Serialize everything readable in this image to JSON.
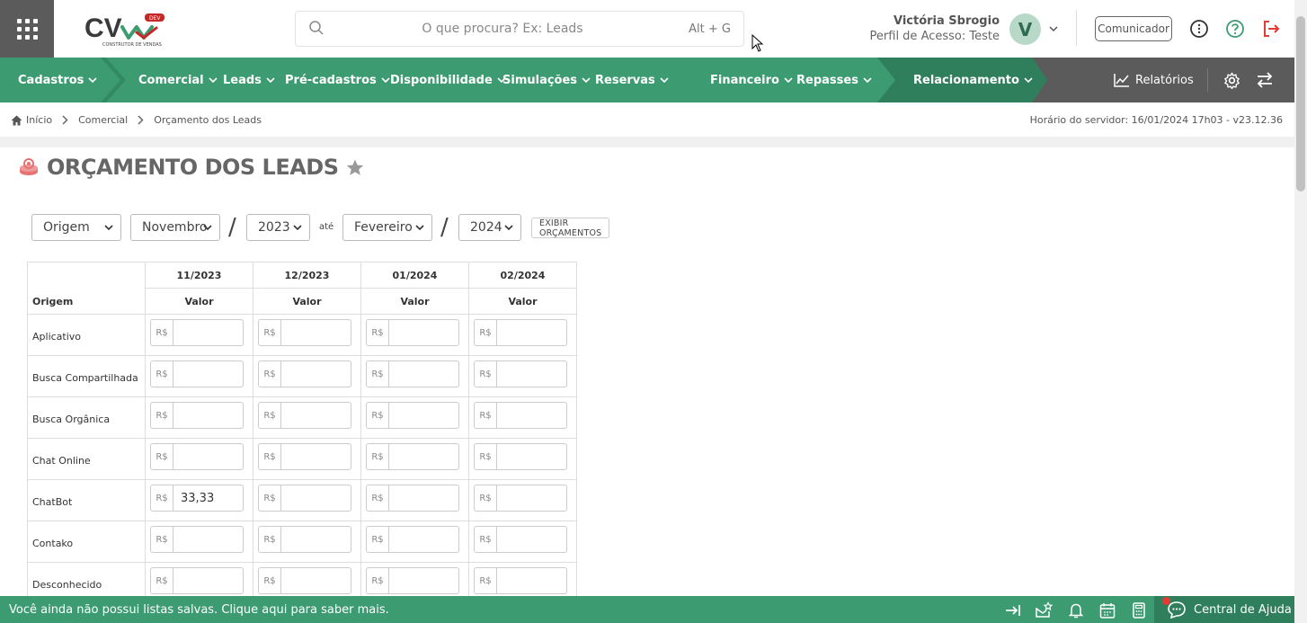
{
  "header": {
    "logo_text": "CV",
    "logo_badge": "DEV",
    "logo_subtitle": "CONSTRUTOR DE VENDAS",
    "search": {
      "placeholder": "O que procura? Ex: Leads",
      "shortcut": "Alt + G"
    },
    "user": {
      "name": "Victória Sbrogio",
      "profile": "Perfil de Acesso: Teste",
      "avatar_letter": "V"
    },
    "communicator_label": "Comunicador",
    "icons": [
      "apps-grid-icon",
      "search-icon",
      "chevron-down-icon",
      "info-icon",
      "help-icon",
      "logout-icon"
    ]
  },
  "nav": {
    "items": [
      {
        "label": "Cadastros"
      },
      {
        "label": "Comercial"
      },
      {
        "label": "Leads"
      },
      {
        "label": "Pré-cadastros"
      },
      {
        "label": "Disponibilidade"
      },
      {
        "label": "Simulações"
      },
      {
        "label": "Reservas"
      },
      {
        "label": "Financeiro"
      },
      {
        "label": "Repasses"
      },
      {
        "label": "Relacionamento"
      }
    ],
    "reports_label": "Relatórios",
    "colors": {
      "primary": "#3d9b71",
      "dark": "#2f7f5c",
      "gray": "#5b5b5b"
    }
  },
  "breadcrumb": {
    "items": [
      "Início",
      "Comercial",
      "Orçamento dos Leads"
    ]
  },
  "server_time": "Horário do servidor: 16/01/2024 17h03 - v23.12.36",
  "page": {
    "title": "ORÇAMENTO DOS LEADS"
  },
  "filters": {
    "group": "Origem",
    "from_month": "Novembro",
    "from_year": "2023",
    "until_label": "até",
    "to_month": "Fevereiro",
    "to_year": "2024",
    "slash": "/",
    "button_label": "EXIBIR ORÇAMENTOS"
  },
  "table": {
    "origin_header": "Origem",
    "value_header": "Valor",
    "currency_prefix": "R$",
    "months": [
      "11/2023",
      "12/2023",
      "01/2024",
      "02/2024"
    ],
    "rows": [
      {
        "origin": "Aplicativo",
        "values": [
          "",
          "",
          "",
          ""
        ]
      },
      {
        "origin": "Busca Compartilhada",
        "values": [
          "",
          "",
          "",
          ""
        ]
      },
      {
        "origin": "Busca Orgânica",
        "values": [
          "",
          "",
          "",
          ""
        ]
      },
      {
        "origin": "Chat Online",
        "values": [
          "",
          "",
          "",
          ""
        ]
      },
      {
        "origin": "ChatBot",
        "values": [
          "33,33",
          "",
          "",
          ""
        ]
      },
      {
        "origin": "Contako",
        "values": [
          "",
          "",
          "",
          ""
        ]
      },
      {
        "origin": "Desconhecido",
        "values": [
          "",
          "",
          "",
          ""
        ]
      }
    ]
  },
  "footer": {
    "message": "Você ainda não possui listas salvas. Clique aqui para saber mais.",
    "help_label": "Central de Ajuda"
  }
}
